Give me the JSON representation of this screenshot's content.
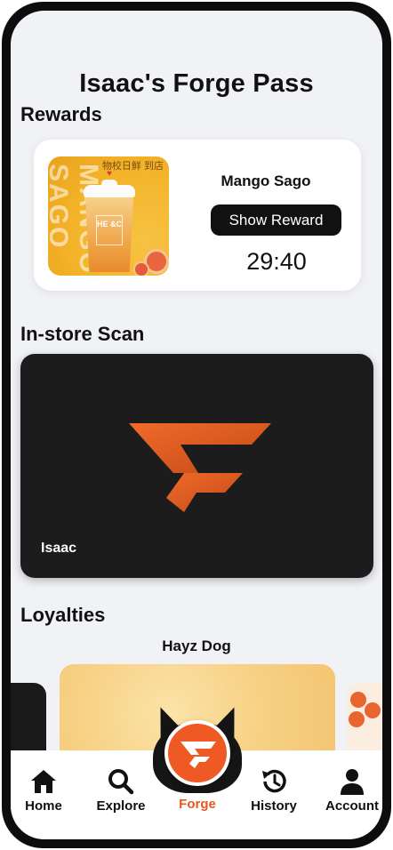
{
  "page": {
    "title": "Isaac's Forge Pass"
  },
  "sections": {
    "rewards": "Rewards",
    "scan": "In-store Scan",
    "loyalties": "Loyalties"
  },
  "reward": {
    "name": "Mango Sago",
    "button_label": "Show Reward",
    "timer": "29:40",
    "image": {
      "bg_text": "MANGO SAGO",
      "cn_text": "物校日鲜 到店",
      "cup_label": "HE &C"
    }
  },
  "scan_card": {
    "name": "Isaac",
    "logo": "forge-logo-icon"
  },
  "loyalty": {
    "current": "Hayz Dog"
  },
  "nav": {
    "items": [
      {
        "label": "Home",
        "icon": "home-icon"
      },
      {
        "label": "Explore",
        "icon": "search-icon"
      },
      {
        "label": "Forge",
        "icon": "forge-logo-icon",
        "active": true
      },
      {
        "label": "History",
        "icon": "history-icon"
      },
      {
        "label": "Account",
        "icon": "account-icon"
      }
    ]
  },
  "colors": {
    "accent": "#ef5a24",
    "background": "#f0f2f6",
    "card_dark": "#1c1c1d"
  }
}
